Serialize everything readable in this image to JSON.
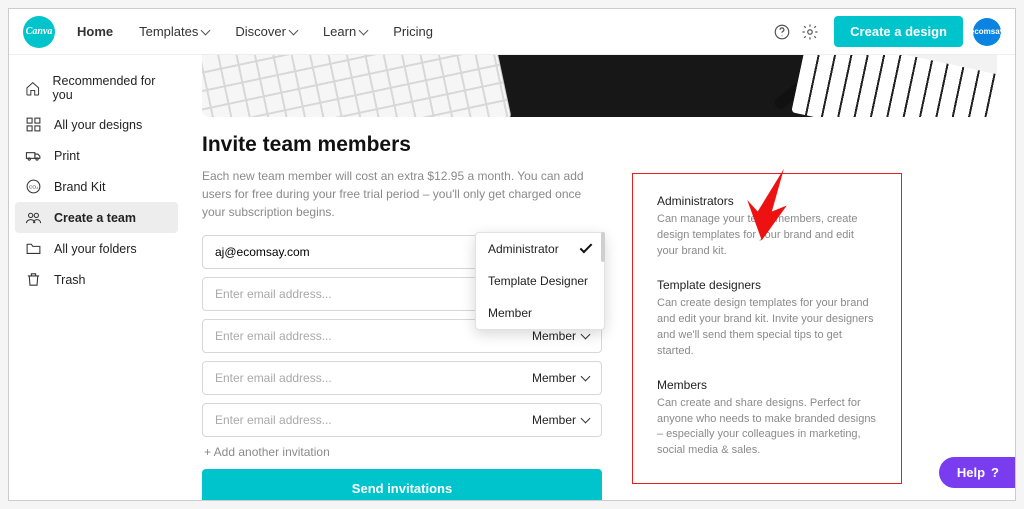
{
  "logo_text": "Canva",
  "nav": {
    "home": "Home",
    "templates": "Templates",
    "discover": "Discover",
    "learn": "Learn",
    "pricing": "Pricing"
  },
  "cta": "Create a design",
  "avatar_label": "ecomsay",
  "sidebar": {
    "recommended": "Recommended for you",
    "all_designs": "All your designs",
    "print": "Print",
    "brand_kit": "Brand Kit",
    "create_team": "Create a team",
    "folders": "All your folders",
    "trash": "Trash"
  },
  "invite": {
    "heading": "Invite team members",
    "description": "Each new team member will cost an extra $12.95 a month. You can add users for free during your free trial period – you'll only get charged once your subscription begins.",
    "placeholder": "Enter email address...",
    "rows": [
      {
        "email": "aj@ecomsay.com",
        "role": "Administrator"
      },
      {
        "email": "",
        "role": "Template Designer"
      },
      {
        "email": "",
        "role": "Member"
      },
      {
        "email": "",
        "role": "Member"
      },
      {
        "email": "",
        "role": "Member"
      }
    ],
    "dropdown": {
      "administrator": "Administrator",
      "template_designer": "Template Designer",
      "member": "Member"
    },
    "add_more": "+ Add another invitation",
    "send": "Send invitations"
  },
  "roles_info": {
    "admin_name": "Administrators",
    "admin_desc": "Can manage your team members, create design templates for your brand and edit your brand kit.",
    "td_name": "Template designers",
    "td_desc": "Can create design templates for your brand and edit your brand kit. Invite your designers and we'll send them special tips to get started.",
    "member_name": "Members",
    "member_desc": "Can create and share designs. Perfect for anyone who needs to make branded designs – especially your colleagues in marketing, social media & sales."
  },
  "help_label": "Help",
  "help_mark": "?"
}
